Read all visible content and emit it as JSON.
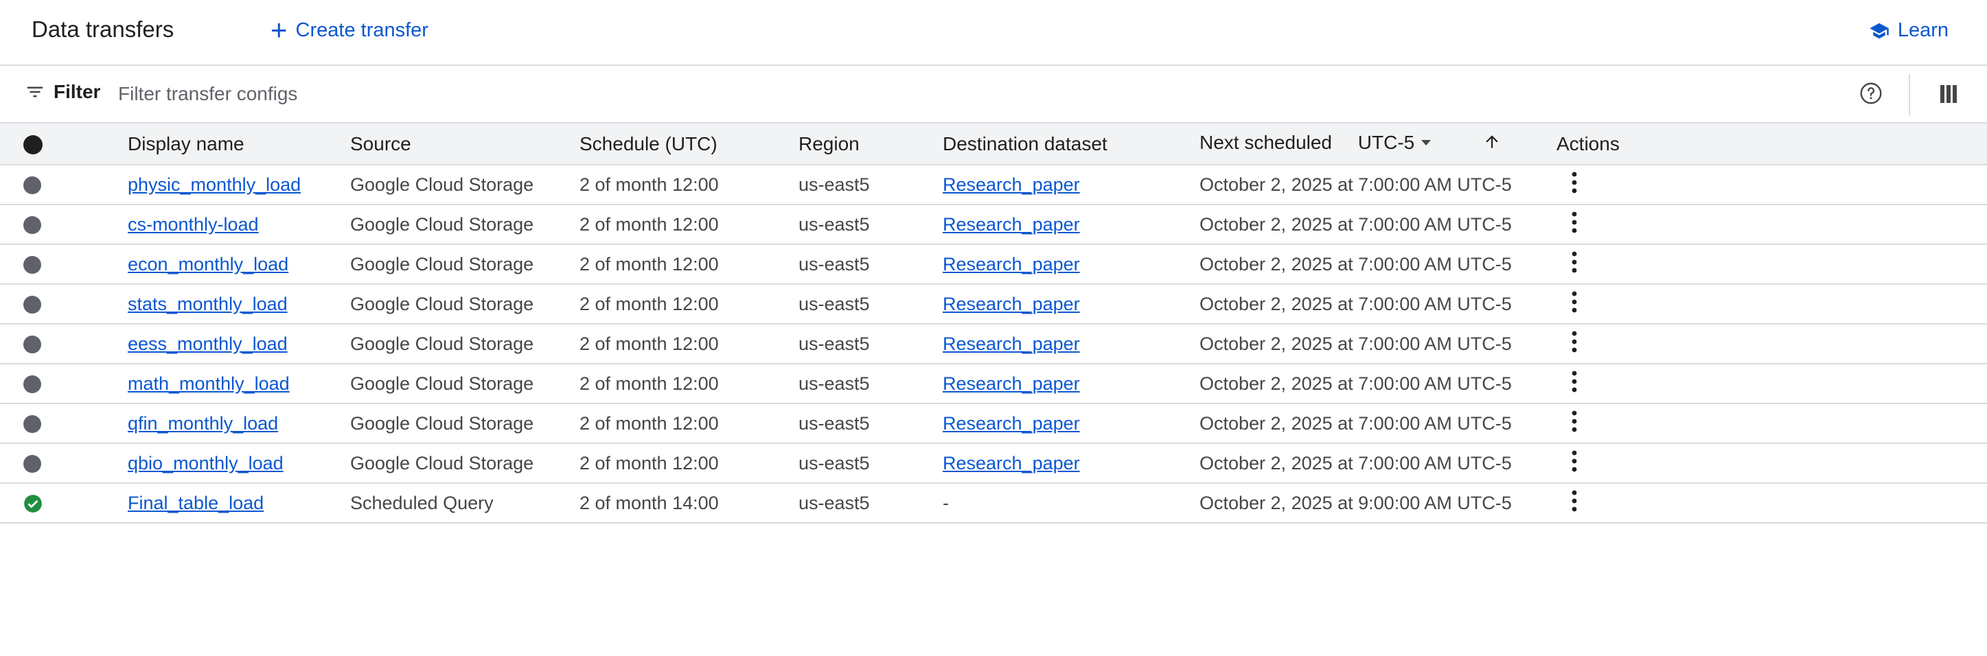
{
  "header": {
    "title": "Data transfers",
    "create_label": "Create transfer",
    "learn_label": "Learn"
  },
  "filterbar": {
    "filter_label": "Filter",
    "placeholder": "Filter transfer configs"
  },
  "table": {
    "columns": {
      "display_name": "Display name",
      "source": "Source",
      "schedule": "Schedule (UTC)",
      "region": "Region",
      "destination": "Destination dataset",
      "next_scheduled": "Next scheduled",
      "timezone": "UTC-5",
      "actions": "Actions"
    },
    "rows": [
      {
        "status": "inactive",
        "name": "physic_monthly_load",
        "source": "Google Cloud Storage",
        "schedule": "2 of month 12:00",
        "region": "us-east5",
        "destination": "Research_paper",
        "next": "October 2, 2025 at 7:00:00 AM UTC-5"
      },
      {
        "status": "inactive",
        "name": "cs-monthly-load",
        "source": "Google Cloud Storage",
        "schedule": "2 of month 12:00",
        "region": "us-east5",
        "destination": "Research_paper",
        "next": "October 2, 2025 at 7:00:00 AM UTC-5"
      },
      {
        "status": "inactive",
        "name": "econ_monthly_load",
        "source": "Google Cloud Storage",
        "schedule": "2 of month 12:00",
        "region": "us-east5",
        "destination": "Research_paper",
        "next": "October 2, 2025 at 7:00:00 AM UTC-5"
      },
      {
        "status": "inactive",
        "name": "stats_monthly_load",
        "source": "Google Cloud Storage",
        "schedule": "2 of month 12:00",
        "region": "us-east5",
        "destination": "Research_paper",
        "next": "October 2, 2025 at 7:00:00 AM UTC-5"
      },
      {
        "status": "inactive",
        "name": "eess_monthly_load",
        "source": "Google Cloud Storage",
        "schedule": "2 of month 12:00",
        "region": "us-east5",
        "destination": "Research_paper",
        "next": "October 2, 2025 at 7:00:00 AM UTC-5"
      },
      {
        "status": "inactive",
        "name": "math_monthly_load",
        "source": "Google Cloud Storage",
        "schedule": "2 of month 12:00",
        "region": "us-east5",
        "destination": "Research_paper",
        "next": "October 2, 2025 at 7:00:00 AM UTC-5"
      },
      {
        "status": "inactive",
        "name": "qfin_monthly_load",
        "source": "Google Cloud Storage",
        "schedule": "2 of month 12:00",
        "region": "us-east5",
        "destination": "Research_paper",
        "next": "October 2, 2025 at 7:00:00 AM UTC-5"
      },
      {
        "status": "inactive",
        "name": "qbio_monthly_load",
        "source": "Google Cloud Storage",
        "schedule": "2 of month 12:00",
        "region": "us-east5",
        "destination": "Research_paper",
        "next": "October 2, 2025 at 7:00:00 AM UTC-5"
      },
      {
        "status": "success",
        "name": "Final_table_load",
        "source": "Scheduled Query",
        "schedule": "2 of month 14:00",
        "region": "us-east5",
        "destination": "-",
        "next": "October 2, 2025 at 9:00:00 AM UTC-5"
      }
    ]
  },
  "colors": {
    "accent": "#0b57d0",
    "status_inactive": "#5f6368",
    "status_success": "#1e8e3e",
    "header_bg": "#f1f3f4"
  }
}
